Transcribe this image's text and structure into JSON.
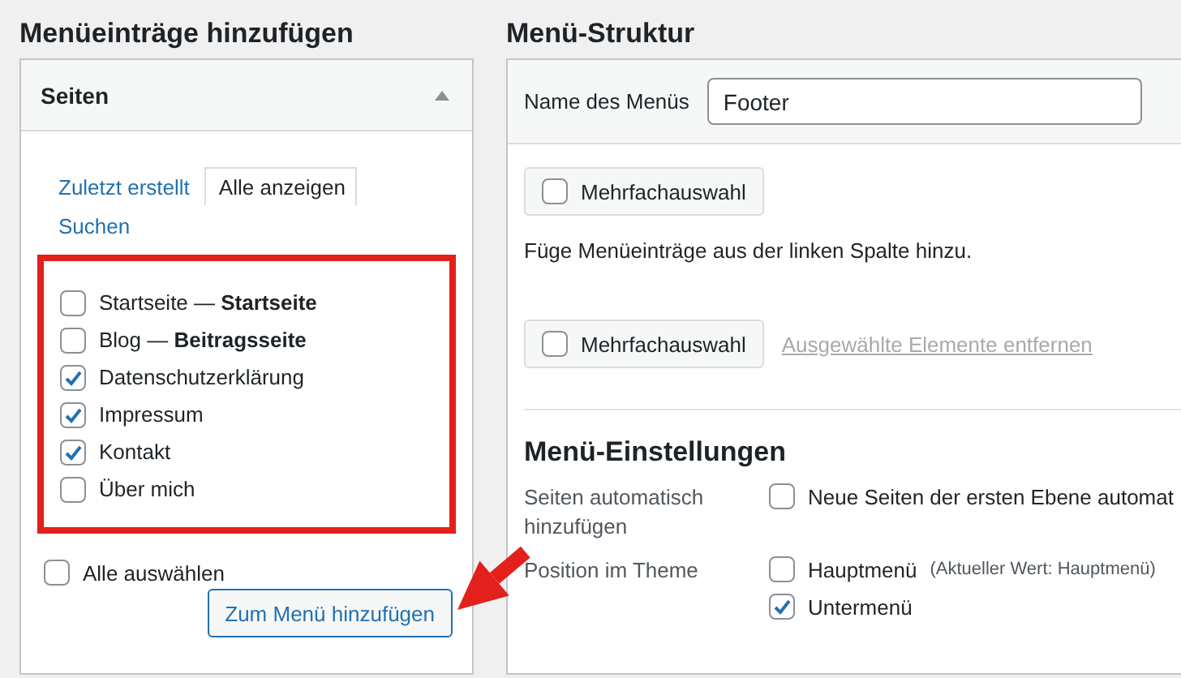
{
  "left": {
    "title": "Menüeinträge hinzufügen",
    "box": {
      "title": "Seiten",
      "expanded": true,
      "tabs": [
        {
          "label": "Zuletzt erstellt",
          "selected": false
        },
        {
          "label": "Alle anzeigen",
          "selected": true
        },
        {
          "label": "Suchen",
          "selected": false
        }
      ],
      "pages": [
        {
          "label": "Startseite — **Startseite**",
          "checked": false
        },
        {
          "label": "Blog — **Beitragsseite**",
          "checked": false
        },
        {
          "label": "Datenschutzerklärung",
          "checked": true
        },
        {
          "label": "Impressum",
          "checked": true
        },
        {
          "label": "Kontakt",
          "checked": true
        },
        {
          "label": "Über mich",
          "checked": false
        }
      ],
      "select_all": {
        "label": "Alle auswählen",
        "checked": false
      },
      "add_button": "Zum Menü hinzufügen"
    }
  },
  "right": {
    "title": "Menü-Struktur",
    "name_label": "Name des Menüs",
    "name_value": "Footer",
    "bulk_select_top": {
      "label": "Mehrfachauswahl",
      "checked": false
    },
    "hint": "Füge Menüeinträge aus der linken Spalte hinzu.",
    "bulk_select_bottom": {
      "label": "Mehrfachauswahl",
      "checked": false
    },
    "remove_link": {
      "label": "Ausgewählte Elemente entfernen",
      "disabled": true
    },
    "settings": {
      "title": "Menü-Einstellungen",
      "rows": [
        {
          "label": "Seiten automatisch hinzufügen",
          "options": [
            {
              "label": "Neue Seiten der ersten Ebene automat",
              "checked": false
            }
          ]
        },
        {
          "label": "Position im Theme",
          "options": [
            {
              "label": "Hauptmenü",
              "note": "(Aktueller Wert: Hauptmenü)",
              "checked": false
            },
            {
              "label": "Untermenü",
              "checked": true
            }
          ]
        }
      ]
    }
  }
}
